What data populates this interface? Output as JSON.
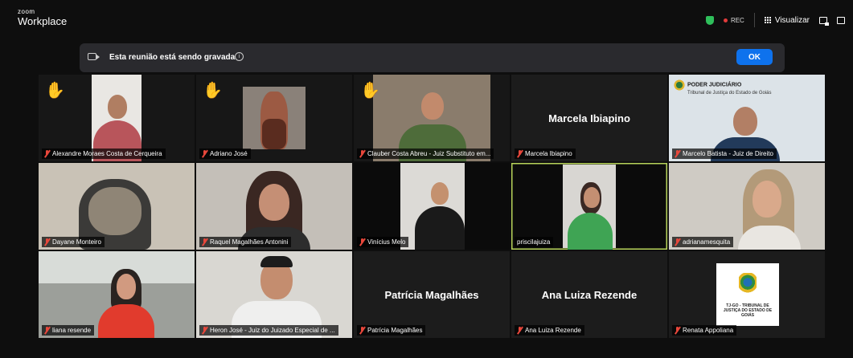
{
  "app": {
    "brand_small": "zoom",
    "brand_big": "Workplace"
  },
  "topbar": {
    "rec_label": "REC",
    "view_label": "Visualizar"
  },
  "banner": {
    "message": "Esta reunião está sendo gravada",
    "info_glyph": "i",
    "ok_label": "OK"
  },
  "tiles": [
    {
      "name": "Alexandre Moraes Costa de Cerqueira",
      "hand": true
    },
    {
      "name": "Adriano José",
      "hand": true
    },
    {
      "name": "Clauber Costa Abreu - Juiz Substituto em...",
      "hand": true
    },
    {
      "name": "Marcela Ibiapino",
      "display_name": "Marcela Ibiapino"
    },
    {
      "name": "Marcelo Batista - Juiz de Direito",
      "logo_title": "PODER JUDICIÁRIO",
      "logo_sub": "Tribunal de Justiça do Estado de Goiás"
    },
    {
      "name": "Dayane Monteiro"
    },
    {
      "name": "Raquel Magalhães Antonini"
    },
    {
      "name": "Vinícius Melo"
    },
    {
      "name": "priscilajuiza"
    },
    {
      "name": "adrianamesquita"
    },
    {
      "name": "liana resende"
    },
    {
      "name": "Heron José - Juiz do Juizado Especial de ..."
    },
    {
      "name": "Patrícia Magalhães",
      "display_name": "Patrícia Magalhães"
    },
    {
      "name": "Ana Luiza Rezende",
      "display_name": "Ana Luiza Rezende"
    },
    {
      "name": "Renata Appoliana",
      "card_text": "TJ-GO - TRIBUNAL DE JUSTIÇA DO ESTADO DE GOIÁS"
    }
  ],
  "colors": {
    "ok_button": "#0e72ed",
    "rec_dot": "#e23b3b",
    "muted_mic": "#e8473b",
    "shield": "#2fbf5b",
    "active_speaker": "#b7d35a"
  }
}
